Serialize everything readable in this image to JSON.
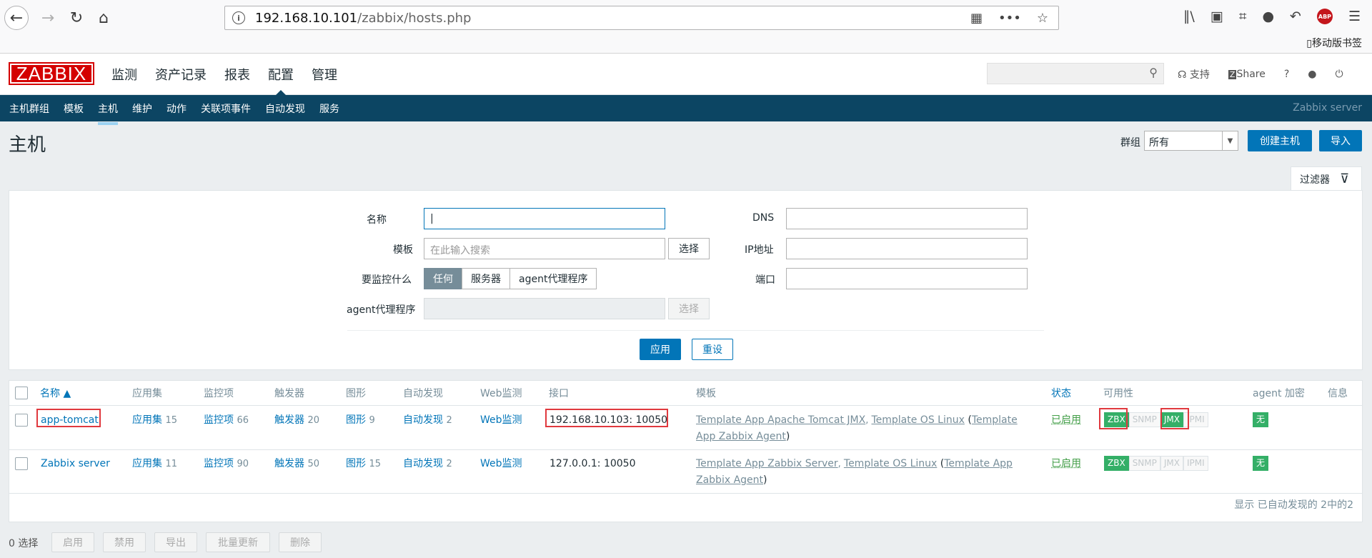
{
  "browser": {
    "url_host": "192.168.10.101",
    "url_path": "/zabbix/hosts.php",
    "mobile_bookmarks": "移动版书签",
    "abp": "ABP"
  },
  "app": {
    "logo": "ZABBIX",
    "menu": [
      "监测",
      "资产记录",
      "报表",
      "配置",
      "管理"
    ],
    "active_menu": "配置",
    "support": "支持",
    "share": "Share",
    "help": "?"
  },
  "subnav": {
    "items": [
      "主机群组",
      "模板",
      "主机",
      "维护",
      "动作",
      "关联项事件",
      "自动发现",
      "服务"
    ],
    "active": "主机",
    "server": "Zabbix server"
  },
  "header": {
    "title": "主机",
    "group_label": "群组",
    "group_value": "所有",
    "create_btn": "创建主机",
    "import_btn": "导入"
  },
  "filter": {
    "tab_label": "过滤器",
    "name_label": "名称",
    "name_value": "|",
    "template_label": "模板",
    "template_placeholder": "在此输入搜索",
    "select": "选择",
    "monitor_label": "要监控什么",
    "monitor_opts": [
      "任何",
      "服务器",
      "agent代理程序"
    ],
    "monitor_active": "任何",
    "proxy_label": "agent代理程序",
    "dns_label": "DNS",
    "ip_label": "IP地址",
    "port_label": "端口",
    "apply": "应用",
    "reset": "重设"
  },
  "table": {
    "headers": {
      "name": "名称 ▲",
      "apps": "应用集",
      "items": "监控项",
      "triggers": "触发器",
      "graphs": "图形",
      "discovery": "自动发现",
      "web": "Web监测",
      "interface": "接口",
      "templates": "模板",
      "status": "状态",
      "availability": "可用性",
      "encryption": "agent 加密",
      "info": "信息"
    },
    "rows": [
      {
        "name": "app-tomcat",
        "apps": "应用集",
        "apps_n": "15",
        "items": "监控项",
        "items_n": "66",
        "triggers": "触发器",
        "triggers_n": "20",
        "graphs": "图形",
        "graphs_n": "9",
        "discovery": "自动发现",
        "discovery_n": "2",
        "web": "Web监测",
        "interface": "192.168.10.103: 10050",
        "t1": "Template App Apache Tomcat JMX",
        "sep1": ", ",
        "t2": "Template OS Linux",
        "t3_open": " (",
        "t3": "Template App Zabbix Agent",
        "t3_close": ")",
        "status": "已启用",
        "zbx": "ZBX",
        "snmp": "SNMP",
        "jmx": "JMX",
        "ipmi": "IPMI",
        "enc": "无"
      },
      {
        "name": "Zabbix server",
        "apps": "应用集",
        "apps_n": "11",
        "items": "监控项",
        "items_n": "90",
        "triggers": "触发器",
        "triggers_n": "50",
        "graphs": "图形",
        "graphs_n": "15",
        "discovery": "自动发现",
        "discovery_n": "2",
        "web": "Web监测",
        "interface": "127.0.0.1: 10050",
        "t1": "Template App Zabbix Server",
        "sep1": ", ",
        "t2": "Template OS Linux",
        "t3_open": " (",
        "t3": "Template App Zabbix Agent",
        "t3_close": ")",
        "status": "已启用",
        "zbx": "ZBX",
        "snmp": "SNMP",
        "jmx": "JMX",
        "ipmi": "IPMI",
        "enc": "无"
      }
    ],
    "footer": "显示 已自动发现的 2中的2"
  },
  "bottom": {
    "selected": "0 选择",
    "buttons": [
      "启用",
      "禁用",
      "导出",
      "批量更新",
      "删除"
    ]
  }
}
